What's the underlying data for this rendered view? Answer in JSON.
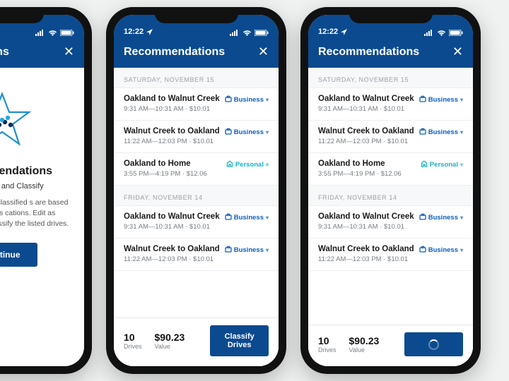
{
  "status": {
    "time": "12:22"
  },
  "header": {
    "title": "Recommendations",
    "title_short": "emmendations"
  },
  "intro": {
    "heading": "Recommendations",
    "tagline": "teview, Edit and Classify",
    "body": "mmedations for unclassified s are based on your previous cations. Edit as necessary, then classify the listed drives.",
    "cta": "Continue"
  },
  "sections": [
    {
      "label": "SATURDAY, NOVEMBER 15",
      "rows": [
        {
          "title": "Oakland to Walnut Creek",
          "meta": "9:31 AM—10:31 AM  ·  $10.01",
          "tag": "Business",
          "kind": "biz"
        },
        {
          "title": "Walnut Creek to Oakland",
          "meta": "11:22 AM—12:03 PM  ·  $10.01",
          "tag": "Business",
          "kind": "biz"
        },
        {
          "title": "Oakland to Home",
          "meta": "3:55 PM—4:19 PM  ·  $12.06",
          "tag": "Personal",
          "kind": "per"
        }
      ]
    },
    {
      "label": "FRIDAY, NOVEMBER 14",
      "rows": [
        {
          "title": "Oakland to Walnut Creek",
          "meta": "9:31 AM—10:31 AM  ·  $10.01",
          "tag": "Business",
          "kind": "biz"
        },
        {
          "title": "Walnut Creek to Oakland",
          "meta": "11:22 AM—12:03 PM  ·  $10.01",
          "tag": "Business",
          "kind": "biz"
        }
      ]
    }
  ],
  "footer": {
    "drives_n": "10",
    "drives_l": "Drives",
    "value_n": "$90.23",
    "value_l": "Value",
    "cta": "Classify Drives"
  }
}
